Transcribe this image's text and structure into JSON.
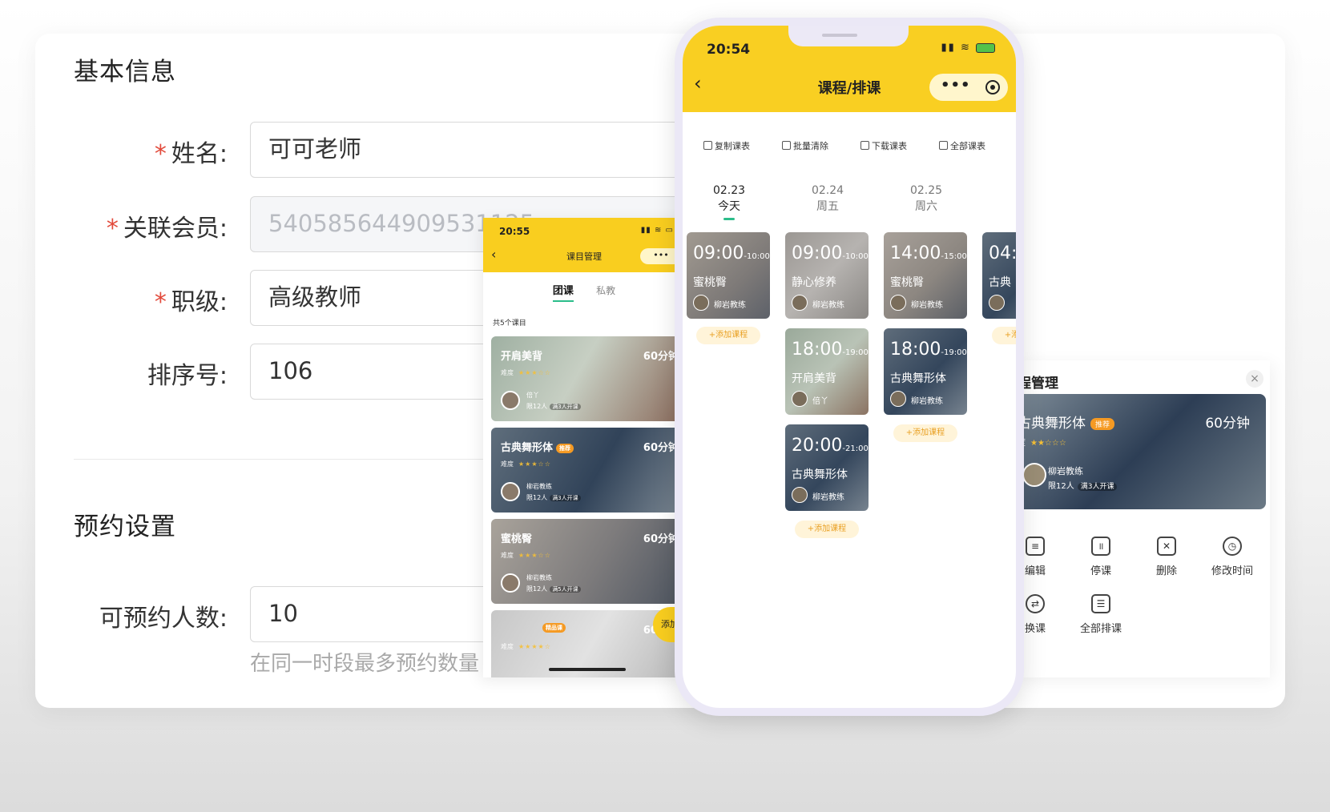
{
  "form": {
    "section_basic": "基本信息",
    "name_label": "姓名:",
    "name_value": "可可老师",
    "member_label": "关联会员:",
    "member_value": "540585644909531125",
    "level_label": "职级:",
    "level_value": "高级教师",
    "sort_label": "排序号:",
    "sort_value": "106",
    "section_booking": "预约设置",
    "capacity_label": "可预约人数:",
    "capacity_value": "10",
    "capacity_hint": "在同一时段最多预约数量",
    "required_mark": "*"
  },
  "small_phone": {
    "time": "20:55",
    "status": "▮▮ ≋ ▭",
    "back": "‹",
    "title": "课目管理",
    "capsule": "•••",
    "tabs": [
      "团课",
      "私教"
    ],
    "count": "共5个课目",
    "add": "添加",
    "courses": [
      {
        "name": "开肩美背",
        "badge": "",
        "duration": "60分钟",
        "difficulty": "难度",
        "stars": "★★★☆☆",
        "coach": "倍丫",
        "limit": "限12人",
        "min": "满3人开课"
      },
      {
        "name": "古典舞形体",
        "badge": "推荐",
        "duration": "60分钟",
        "difficulty": "难度",
        "stars": "★★★☆☆",
        "coach": "柳岩教练",
        "limit": "限12人",
        "min": "满3人开课"
      },
      {
        "name": "蜜桃臀",
        "badge": "",
        "duration": "60分钟",
        "difficulty": "难度",
        "stars": "★★★☆☆",
        "coach": "柳岩教练",
        "limit": "限12人",
        "min": "满5人开课"
      },
      {
        "name": "",
        "badge": "精品课",
        "duration": "60分钟",
        "difficulty": "难度",
        "stars": "★★★★☆",
        "coach": "",
        "limit": "",
        "min": ""
      }
    ]
  },
  "big_phone": {
    "time": "20:54",
    "back": "‹",
    "title": "课程/排课",
    "capsule_dots": "•••",
    "tools": [
      "复制课表",
      "批量清除",
      "下载课表",
      "全部课表"
    ],
    "dates": [
      {
        "date": "02.23",
        "day": "今天"
      },
      {
        "date": "02.24",
        "day": "周五"
      },
      {
        "date": "02.25",
        "day": "周六"
      }
    ],
    "add_course": "+添加课程",
    "col0": [
      {
        "time": "09:00",
        "end": "-10:00",
        "name": "蜜桃臀",
        "coach": "柳岩教练"
      }
    ],
    "col1": [
      {
        "time": "09:00",
        "end": "-10:00",
        "name": "静心修养",
        "coach": "柳岩教练"
      },
      {
        "time": "18:00",
        "end": "-19:00",
        "name": "开肩美背",
        "coach": "倍丫"
      },
      {
        "time": "20:00",
        "end": "-21:00",
        "name": "古典舞形体",
        "coach": "柳岩教练"
      }
    ],
    "col2": [
      {
        "time": "14:00",
        "end": "-15:00",
        "name": "蜜桃臀",
        "coach": "柳岩教练"
      },
      {
        "time": "18:00",
        "end": "-19:00",
        "name": "古典舞形体",
        "coach": "柳岩教练"
      }
    ],
    "col3": [
      {
        "time": "04:",
        "end": "",
        "name": "古典",
        "coach": ""
      }
    ]
  },
  "right_card": {
    "title": "程管理",
    "close": "×",
    "course_name": "古典舞形体",
    "badge": "推荐",
    "duration": "60分钟",
    "difficulty": "度",
    "stars": "★★☆☆☆",
    "coach": "柳岩教练",
    "limit": "限12人",
    "min": "满3人开课",
    "actions": [
      "编辑",
      "停课",
      "删除",
      "修改时间",
      "换课",
      "全部排课"
    ]
  }
}
